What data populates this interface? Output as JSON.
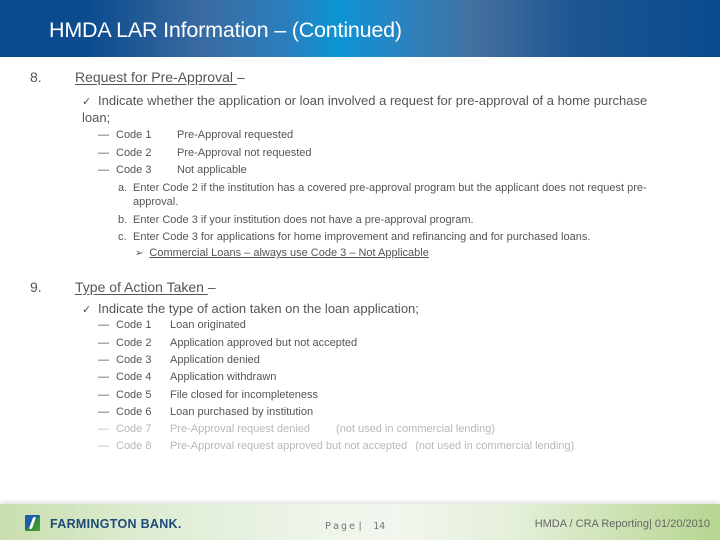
{
  "header": {
    "title": "HMDA LAR Information – (Continued)"
  },
  "sections": [
    {
      "number": "8.",
      "title": "Request for Pre-Approval ",
      "title_suffix": "–",
      "check_text": "Indicate whether the application or loan involved a request for pre-approval of a home purchase loan;",
      "codes": [
        {
          "code": "Code 1",
          "desc": "Pre-Approval requested"
        },
        {
          "code": "Code 2",
          "desc": "Pre-Approval not requested"
        },
        {
          "code": "Code 3",
          "desc": "Not applicable"
        }
      ],
      "notes": [
        {
          "letter": "a.",
          "text": "Enter Code 2 if the institution has a covered pre-approval program but the applicant does not request pre-approval."
        },
        {
          "letter": "b.",
          "text": "Enter Code 3 if your institution does not have a pre-approval program."
        },
        {
          "letter": "c.",
          "text": "Enter Code 3 for applications for home improvement and refinancing and for purchased loans."
        }
      ],
      "sub_note": "Commercial Loans – always use Code 3 – Not Applicable"
    },
    {
      "number": "9.",
      "title": "Type of Action Taken ",
      "title_suffix": "–",
      "check_text": "Indicate the type of action taken on the loan application;",
      "codes": [
        {
          "code": "Code 1",
          "desc": "Loan originated",
          "note": ""
        },
        {
          "code": "Code 2",
          "desc": "Application approved but not accepted",
          "note": ""
        },
        {
          "code": "Code 3",
          "desc": "Application denied",
          "note": ""
        },
        {
          "code": "Code 4",
          "desc": "Application withdrawn",
          "note": ""
        },
        {
          "code": "Code 5",
          "desc": "File closed for incompleteness",
          "note": ""
        },
        {
          "code": "Code 6",
          "desc": "Loan purchased by institution",
          "note": ""
        },
        {
          "code": "Code 7",
          "desc": "Pre-Approval request denied",
          "note": "(not used in commercial lending)"
        },
        {
          "code": "Code 8",
          "desc": "Pre-Approval request approved but not accepted",
          "note": "(not used in commercial lending)"
        }
      ]
    }
  ],
  "icons": {
    "check": "✓",
    "dash": "—",
    "arrow": "➢"
  },
  "footer": {
    "logo_text": "FARMINGTON BANK.",
    "page_label": "Page|",
    "page_number": "14",
    "right_text": "HMDA / CRA Reporting| 01/20/2010"
  },
  "colors": {
    "header_blue": "#0a4a8f",
    "header_cyan": "#0c94d4",
    "text_gray": "#555555",
    "footer_green": "#b6d590",
    "logo_navy": "#1e4a7a"
  }
}
